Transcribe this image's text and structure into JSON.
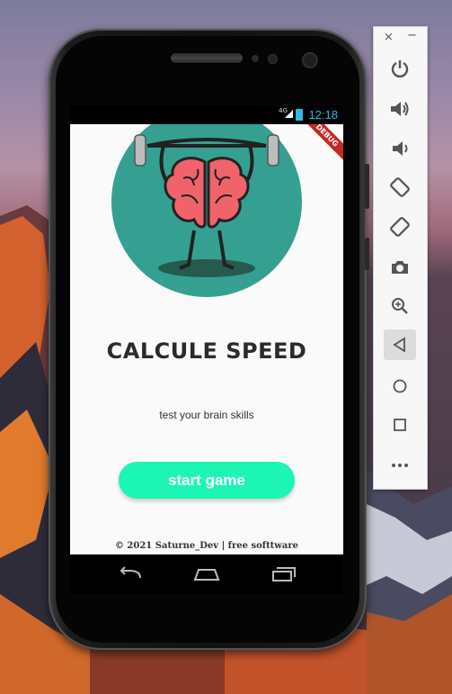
{
  "status_bar": {
    "network": "4G",
    "time": "12:18"
  },
  "debug_banner": "DEBUG",
  "app": {
    "title": "CALCULE SPEED",
    "subtitle": "test your brain skills",
    "start_button": "start game",
    "footer": "© 2021 Saturne_Dev | free softtware"
  },
  "colors": {
    "accent_button": "#1df5b4",
    "logo_circle": "#35a092",
    "brain": "#f0636a"
  },
  "emulator_panel": {
    "window_close": "×",
    "window_minimize": "−",
    "buttons": [
      "power-icon",
      "volume-up-icon",
      "volume-down-icon",
      "rotate-left-icon",
      "rotate-right-icon",
      "camera-icon",
      "zoom-icon",
      "back-icon",
      "home-icon",
      "overview-icon",
      "more-icon"
    ]
  },
  "navigation_bar": [
    "back-icon",
    "home-icon",
    "recents-icon"
  ]
}
